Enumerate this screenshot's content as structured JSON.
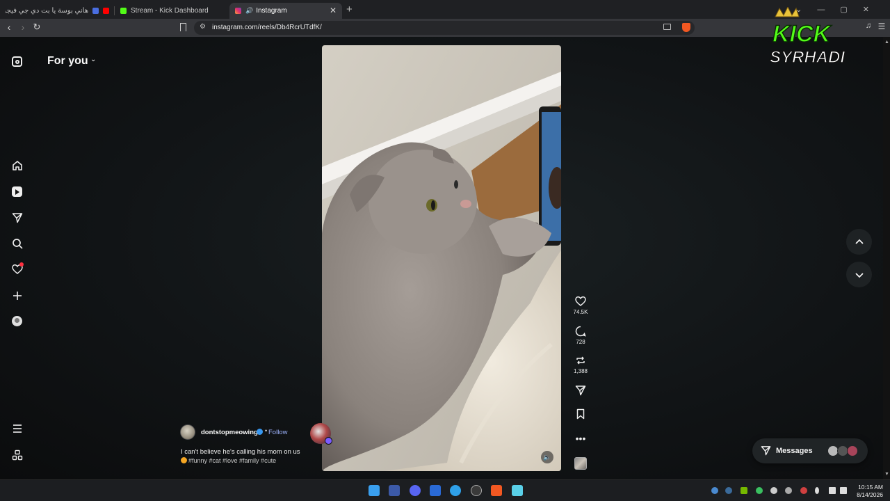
{
  "browser": {
    "tabs": [
      {
        "label": "هاني بوسة يا بت دي جي فيجو اوزك",
        "active": false
      },
      {
        "label": "Stream - Kick Dashboard",
        "active": false
      },
      {
        "label": "Instagram",
        "active": true
      }
    ],
    "new_tab": "+",
    "url": "instagram.com/reels/Db4RcrUTdfK/",
    "window_controls": {
      "dropdown": "⌄",
      "minimize": "—",
      "maximize": "▢",
      "close": "✕"
    }
  },
  "sidebar": {
    "items": [
      {
        "icon": "instagram-logo-icon"
      },
      {
        "icon": "home-icon"
      },
      {
        "icon": "reels-icon"
      },
      {
        "icon": "direct-messages-icon"
      },
      {
        "icon": "search-icon"
      },
      {
        "icon": "notifications-heart-icon",
        "has_badge": true
      },
      {
        "icon": "create-plus-icon"
      },
      {
        "icon": "profile-icon"
      },
      {
        "icon": "menu-icon"
      },
      {
        "icon": "also-from-meta-icon"
      }
    ]
  },
  "feed": {
    "title": "For you",
    "title_chevron": "⌄"
  },
  "reel": {
    "username": "dontstopmeowing",
    "verified": true,
    "separator": "•",
    "follow_label": "Follow",
    "caption": "I can't believe he's calling his mom on us",
    "hashtags": "#funny #cat #love #family #cute",
    "actions": {
      "likes": "74.5K",
      "comments": "728",
      "reposts": "1,388"
    }
  },
  "messages": {
    "label": "Messages"
  },
  "overlay": {
    "line1": "KICK",
    "line2": "SYRHADI"
  },
  "taskbar": {
    "time": "10:15 AM",
    "date": "8/14/2026"
  },
  "colors": {
    "accent_follow": "#9fb4ff",
    "verified_blue": "#3897f0",
    "notification_red": "#ff3040",
    "kick_green": "#53fc18"
  }
}
